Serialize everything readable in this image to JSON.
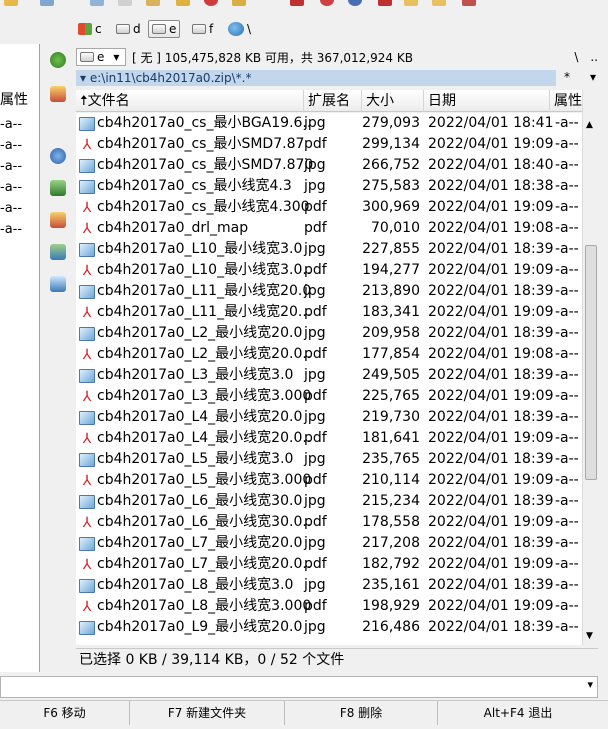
{
  "drives": [
    {
      "letter": "c",
      "active": false
    },
    {
      "letter": "d",
      "active": false
    },
    {
      "letter": "e",
      "active": true
    },
    {
      "letter": "f",
      "active": false
    },
    {
      "letter": "\\",
      "active": false
    }
  ],
  "left_panel": {
    "top_buttons": [
      "\\",
      ".."
    ],
    "filter": "*",
    "header": "属性",
    "attrs": [
      "-a--",
      "-a--",
      "-a--",
      "-a--",
      "-a--",
      "-a--"
    ]
  },
  "path_bar": {
    "drive_combo": "e",
    "free_space": "[ 无 ] 105,475,828 KB 可用，共 367,012,924 KB",
    "right_buttons": [
      "\\",
      ".."
    ],
    "filter": "*"
  },
  "address": "e:\\in11\\cb4h2017a0.zip\\*.*",
  "columns": {
    "name": "文件名",
    "ext": "扩展名",
    "size": "大小",
    "date": "日期",
    "attr": "属性"
  },
  "files": [
    {
      "name": "cb4h2017a0_cs_最小BGA19.6..",
      "ext": "jpg",
      "size": "279,093",
      "date": "2022/04/01 18:41",
      "attr": "-a--"
    },
    {
      "name": "cb4h2017a0_cs_最小SMD7.87",
      "ext": "pdf",
      "size": "299,134",
      "date": "2022/04/01 19:09",
      "attr": "-a--"
    },
    {
      "name": "cb4h2017a0_cs_最小SMD7.870",
      "ext": "jpg",
      "size": "266,752",
      "date": "2022/04/01 18:40",
      "attr": "-a--"
    },
    {
      "name": "cb4h2017a0_cs_最小线宽4.3",
      "ext": "jpg",
      "size": "275,583",
      "date": "2022/04/01 18:38",
      "attr": "-a--"
    },
    {
      "name": "cb4h2017a0_cs_最小线宽4.300",
      "ext": "pdf",
      "size": "300,969",
      "date": "2022/04/01 19:09",
      "attr": "-a--"
    },
    {
      "name": "cb4h2017a0_drl_map",
      "ext": "pdf",
      "size": "70,010",
      "date": "2022/04/01 19:08",
      "attr": "-a--"
    },
    {
      "name": "cb4h2017a0_L10_最小线宽3.0",
      "ext": "jpg",
      "size": "227,855",
      "date": "2022/04/01 18:39",
      "attr": "-a--"
    },
    {
      "name": "cb4h2017a0_L10_最小线宽3.0..",
      "ext": "pdf",
      "size": "194,277",
      "date": "2022/04/01 19:09",
      "attr": "-a--"
    },
    {
      "name": "cb4h2017a0_L11_最小线宽20.0",
      "ext": "jpg",
      "size": "213,890",
      "date": "2022/04/01 18:39",
      "attr": "-a--"
    },
    {
      "name": "cb4h2017a0_L11_最小线宽20...",
      "ext": "pdf",
      "size": "183,341",
      "date": "2022/04/01 19:09",
      "attr": "-a--"
    },
    {
      "name": "cb4h2017a0_L2_最小线宽20.0",
      "ext": "jpg",
      "size": "209,958",
      "date": "2022/04/01 18:39",
      "attr": "-a--"
    },
    {
      "name": "cb4h2017a0_L2_最小线宽20.0..",
      "ext": "pdf",
      "size": "177,854",
      "date": "2022/04/01 19:08",
      "attr": "-a--"
    },
    {
      "name": "cb4h2017a0_L3_最小线宽3.0",
      "ext": "jpg",
      "size": "249,505",
      "date": "2022/04/01 18:39",
      "attr": "-a--"
    },
    {
      "name": "cb4h2017a0_L3_最小线宽3.000",
      "ext": "pdf",
      "size": "225,765",
      "date": "2022/04/01 19:09",
      "attr": "-a--"
    },
    {
      "name": "cb4h2017a0_L4_最小线宽20.0",
      "ext": "jpg",
      "size": "219,730",
      "date": "2022/04/01 18:39",
      "attr": "-a--"
    },
    {
      "name": "cb4h2017a0_L4_最小线宽20.0..",
      "ext": "pdf",
      "size": "181,641",
      "date": "2022/04/01 19:09",
      "attr": "-a--"
    },
    {
      "name": "cb4h2017a0_L5_最小线宽3.0",
      "ext": "jpg",
      "size": "235,765",
      "date": "2022/04/01 18:39",
      "attr": "-a--"
    },
    {
      "name": "cb4h2017a0_L5_最小线宽3.000",
      "ext": "pdf",
      "size": "210,114",
      "date": "2022/04/01 19:09",
      "attr": "-a--"
    },
    {
      "name": "cb4h2017a0_L6_最小线宽30.0",
      "ext": "jpg",
      "size": "215,234",
      "date": "2022/04/01 18:39",
      "attr": "-a--"
    },
    {
      "name": "cb4h2017a0_L6_最小线宽30.0..",
      "ext": "pdf",
      "size": "178,558",
      "date": "2022/04/01 19:09",
      "attr": "-a--"
    },
    {
      "name": "cb4h2017a0_L7_最小线宽20.0",
      "ext": "jpg",
      "size": "217,208",
      "date": "2022/04/01 18:39",
      "attr": "-a--"
    },
    {
      "name": "cb4h2017a0_L7_最小线宽20.0..",
      "ext": "pdf",
      "size": "182,792",
      "date": "2022/04/01 19:09",
      "attr": "-a--"
    },
    {
      "name": "cb4h2017a0_L8_最小线宽3.0",
      "ext": "jpg",
      "size": "235,161",
      "date": "2022/04/01 18:39",
      "attr": "-a--"
    },
    {
      "name": "cb4h2017a0_L8_最小线宽3.000",
      "ext": "pdf",
      "size": "198,929",
      "date": "2022/04/01 19:09",
      "attr": "-a--"
    },
    {
      "name": "cb4h2017a0_L9_最小线宽20.0",
      "ext": "jpg",
      "size": "216,486",
      "date": "2022/04/01 18:39",
      "attr": "-a--"
    }
  ],
  "status": "已选择 0 KB / 39,114 KB，0 / 52 个文件",
  "fkeys": [
    "F6 移动",
    "F7 新建文件夹",
    "F8 删除",
    "Alt+F4 退出"
  ],
  "colors": {
    "address_bg": "#c2d6ec",
    "pdf_icon": "#d21f1f",
    "jpg_icon": "#6ea8d6"
  }
}
